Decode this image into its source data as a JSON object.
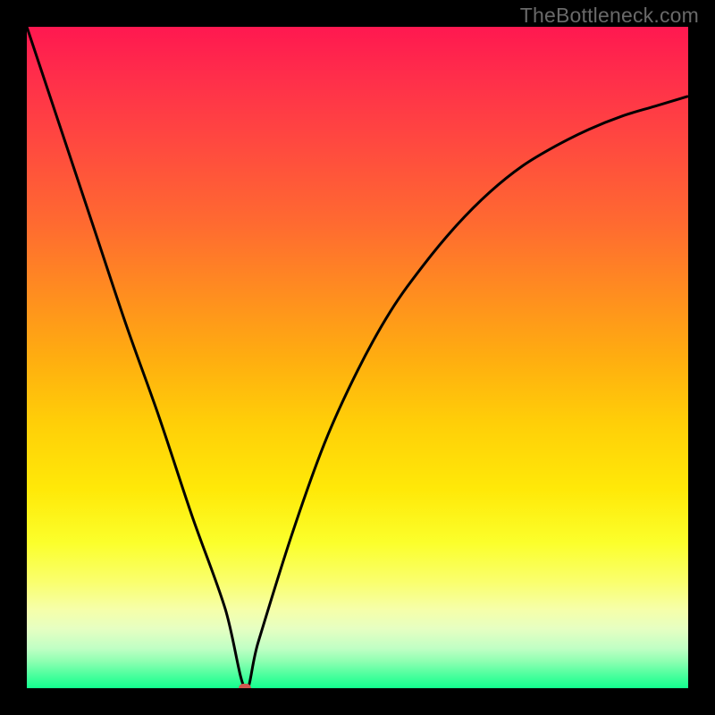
{
  "watermark": "TheBottleneck.com",
  "colors": {
    "frame_bg": "#000000",
    "curve_stroke": "#000000",
    "dot_fill": "#d0584f"
  },
  "chart_data": {
    "type": "line",
    "title": "",
    "xlabel": "",
    "ylabel": "",
    "xlim": [
      0,
      100
    ],
    "ylim": [
      0,
      100
    ],
    "x": [
      0,
      5,
      10,
      15,
      20,
      25,
      30,
      33,
      35,
      40,
      45,
      50,
      55,
      60,
      65,
      70,
      75,
      80,
      85,
      90,
      95,
      100
    ],
    "values": [
      100,
      85,
      70,
      55,
      41,
      26,
      12,
      0,
      7,
      23,
      37,
      48,
      57,
      64,
      70,
      75,
      79,
      82,
      84.5,
      86.5,
      88,
      89.5
    ],
    "marker_point": {
      "x": 33,
      "y": 0
    },
    "annotations": [],
    "gradient_direction": "y",
    "gradient_stops": [
      {
        "pos": 0.0,
        "color": "#12ff8e"
      },
      {
        "pos": 0.04,
        "color": "#8cffb1"
      },
      {
        "pos": 0.09,
        "color": "#e6ffc2"
      },
      {
        "pos": 0.16,
        "color": "#faff6e"
      },
      {
        "pos": 0.3,
        "color": "#ffe908"
      },
      {
        "pos": 0.5,
        "color": "#ffad10"
      },
      {
        "pos": 0.7,
        "color": "#ff6b30"
      },
      {
        "pos": 1.0,
        "color": "#ff1850"
      }
    ]
  }
}
